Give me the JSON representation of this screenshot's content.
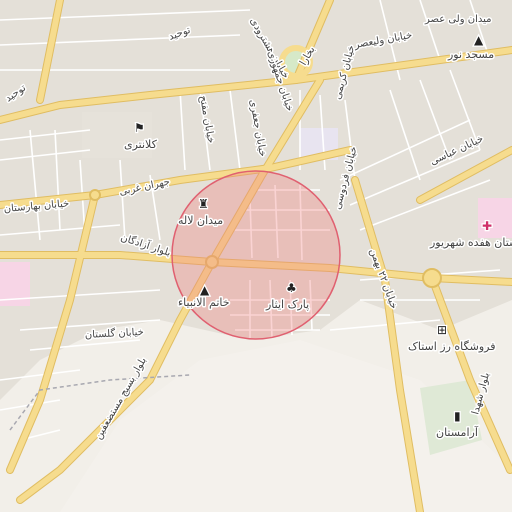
{
  "map": {
    "colors": {
      "background": "#f2efe9",
      "block": "#e4e0d8",
      "minor_road": "#ffffff",
      "major_road": "#f6dc8e",
      "major_road_casing": "#e0bd62",
      "park": "#d6e9c8",
      "hospital": "#f7d5e6",
      "radius_fill": "#f08080",
      "radius_stroke": "#e06070"
    },
    "search_radius": {
      "center_label": "center",
      "visible": true
    },
    "road_labels": {
      "toohid_top": "توحید",
      "toohid_left": "توحید",
      "vali_asr_street": "خیابان ولیعصر",
      "vali_asr_square": "میدان ولی عصر",
      "hashtrudi": "خیابان هشترودی",
      "jomhouri": "خیابان جمهوری",
      "jafari": "خیابان جعفری",
      "mofatteh": "خیابان مفتح",
      "karimi": "خیابان کریمی",
      "bokhara": "بخارا",
      "joharan": "جهران غربی",
      "baharestan": "خیابان بهارستان",
      "golestan": "خیابان گلستان",
      "azadegan": "بلوار آزادگان",
      "mostazafin": "بلوار بسیج مستضعفین",
      "ferdowsi": "خیابان فردوسی",
      "abbasi": "خیابان عباسی",
      "bahman": "خیابان ۲۲ بهمن",
      "shohada": "بلوار شهدا"
    },
    "pois": [
      {
        "name": "poi-masjed-noor",
        "icon": "mosque-icon",
        "glyph": "▲",
        "label": "مسجد نور"
      },
      {
        "name": "poi-kalantari",
        "icon": "police-icon",
        "glyph": "⚑",
        "label": "کلانتری"
      },
      {
        "name": "poi-meydan-laleh",
        "icon": "monument-icon",
        "glyph": "♜",
        "label": "میدان لاله"
      },
      {
        "name": "poi-khatam",
        "icon": "mosque-icon",
        "glyph": "▲",
        "label": "خاتم الانبیاء"
      },
      {
        "name": "poi-park-isar",
        "icon": "tree-icon",
        "glyph": "♣",
        "label": "پارک ایثار"
      },
      {
        "name": "poi-hospital",
        "icon": "hospital-icon",
        "glyph": "✚",
        "label": "بیمارستان هفده شهریور"
      },
      {
        "name": "poi-store",
        "icon": "shopping-cart-icon",
        "glyph": "⊞",
        "label": "فروشگاه رز استاک"
      },
      {
        "name": "poi-cemetery",
        "icon": "cemetery-icon",
        "glyph": "▮",
        "label": "آرامستان"
      }
    ]
  }
}
